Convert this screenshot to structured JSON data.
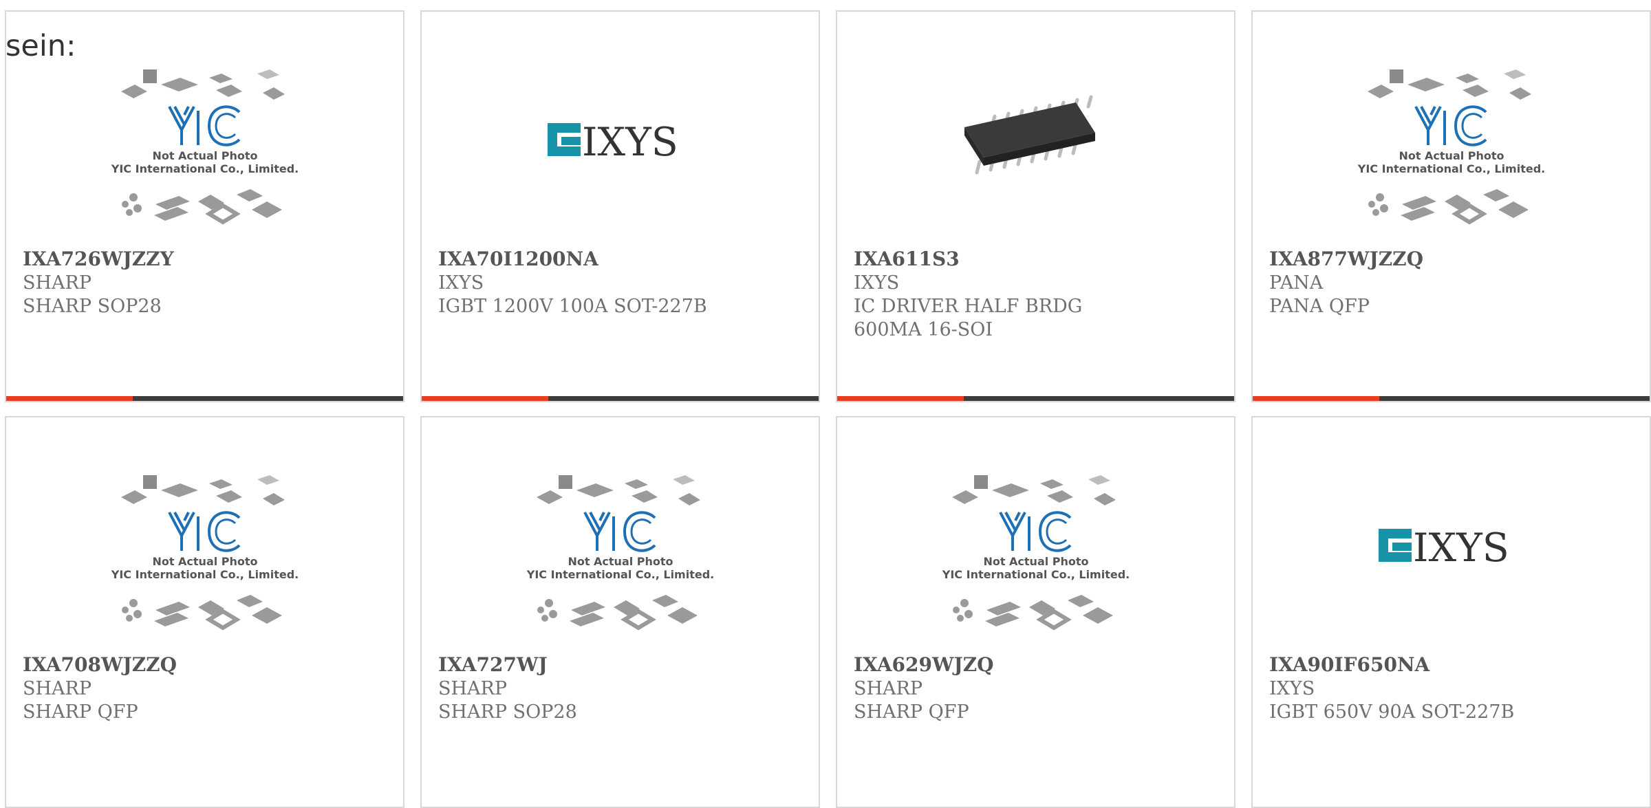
{
  "intro_text": "sein:",
  "colors": {
    "accent": "#e8401c",
    "bar": "#3d3d3d",
    "yic_blue": "#1d6fb6",
    "ixys_teal": "#1793a8"
  },
  "placeholder_image": {
    "line1": "Not Actual Photo",
    "line2": "YIC International Co., Limited."
  },
  "ixys_logo_text": "IXYS",
  "products": [
    {
      "part": "IXA726WJZZY",
      "manufacturer": "SHARP",
      "description": "SHARP SOP28",
      "image": "yic-placeholder"
    },
    {
      "part": "IXA70I1200NA",
      "manufacturer": "IXYS",
      "description": "IGBT 1200V 100A SOT-227B",
      "image": "ixys-logo"
    },
    {
      "part": "IXA611S3",
      "manufacturer": "IXYS",
      "description": "IC DRIVER HALF BRDG 600MA 16-SOI",
      "image": "chip-photo"
    },
    {
      "part": "IXA877WJZZQ",
      "manufacturer": "PANA",
      "description": "PANA QFP",
      "image": "yic-placeholder"
    },
    {
      "part": "IXA708WJZZQ",
      "manufacturer": "SHARP",
      "description": "SHARP QFP",
      "image": "yic-placeholder"
    },
    {
      "part": "IXA727WJ",
      "manufacturer": "SHARP",
      "description": "SHARP SOP28",
      "image": "yic-placeholder"
    },
    {
      "part": "IXA629WJZQ",
      "manufacturer": "SHARP",
      "description": "SHARP QFP",
      "image": "yic-placeholder"
    },
    {
      "part": "IXA90IF650NA",
      "manufacturer": "IXYS",
      "description": "IGBT 650V 90A SOT-227B",
      "image": "ixys-logo"
    }
  ]
}
